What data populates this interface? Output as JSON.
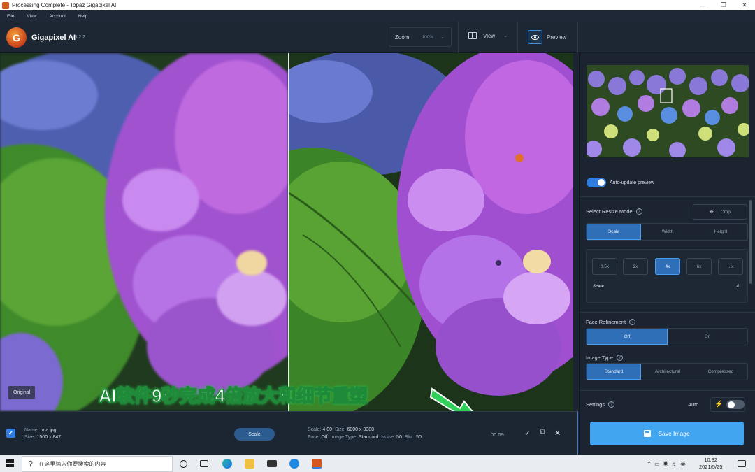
{
  "window": {
    "title": "Processing Complete - Topaz Gigapixel AI"
  },
  "menu": [
    "File",
    "View",
    "Account",
    "Help"
  ],
  "header": {
    "logo_letter": "G",
    "brand": "Gigapixel AI",
    "version": "v5.2.2",
    "zoom_label": "Zoom",
    "zoom_value": "100%",
    "view_label": "View",
    "preview_label": "Preview"
  },
  "viewer": {
    "original_label": "Original",
    "overlay_caption": "AI软件9秒完成4倍放大和细节重塑"
  },
  "bottom": {
    "name_label": "Name:",
    "name_value": "hua.jpg",
    "size_label": "Size:",
    "size_value": "1500 x 847",
    "scale_button": "Scale",
    "scale_label": "Scale:",
    "scale_value": "4.00",
    "out_size_label": "Size:",
    "out_size_value": "6000 x 3388",
    "face_label": "Face:",
    "face_value": "Off",
    "image_type_label": "Image Type:",
    "image_type_value": "Standard",
    "noise_label": "Noise:",
    "noise_value": "50",
    "blur_label": "Blur:",
    "blur_value": "50",
    "timer": "00:09"
  },
  "panel": {
    "auto_update": "Auto-update preview",
    "resize_mode_title": "Select Resize Mode",
    "crop": "Crop",
    "resize_tabs": [
      "Scale",
      "Width",
      "Height"
    ],
    "scale_options": [
      "0.5x",
      "2x",
      "4x",
      "6x",
      "...x"
    ],
    "scale_row_label": "Scale",
    "scale_row_value": "4",
    "face_title": "Face Refinement",
    "face_options": [
      "Off",
      "On"
    ],
    "image_type_title": "Image Type",
    "image_type_options": [
      "Standard",
      "Architectural",
      "Compressed"
    ],
    "settings_title": "Settings",
    "auto_label": "Auto",
    "save_button": "Save Image",
    "help_glyph": "?"
  },
  "taskbar": {
    "search_placeholder": "在这里输入你要搜索的内容",
    "ime": "英",
    "time": "10:32",
    "date": "2021/5/25"
  },
  "colors": {
    "accent": "#2f7de0",
    "save": "#42a5f0",
    "panel_bg": "#1b2430"
  }
}
